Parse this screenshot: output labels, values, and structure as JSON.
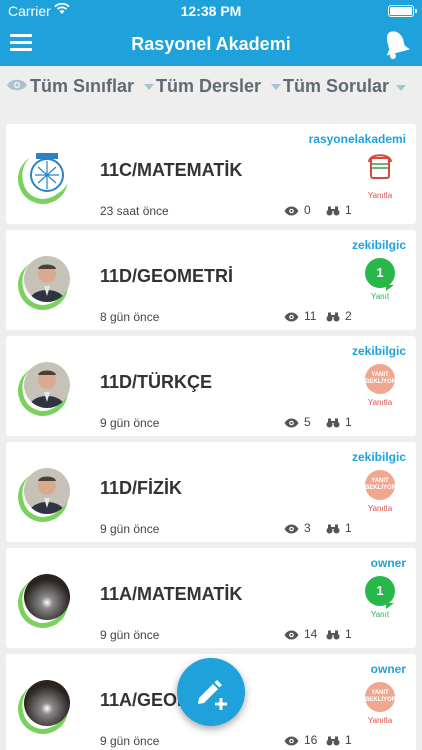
{
  "status_bar": {
    "carrier": "Carrier",
    "time": "12:38 PM"
  },
  "header": {
    "title": "Rasyonel Akademi"
  },
  "filters": {
    "classes": "Tüm Sınıflar",
    "subjects": "Tüm Dersler",
    "questions": "Tüm Sorular"
  },
  "questions": [
    {
      "user": "rasyonelakademi",
      "course": "11C/MATEMATİK",
      "time": "23 saat önce",
      "views": "0",
      "answers": "1",
      "status_label": "Yanıtla",
      "status_type": "waiting"
    },
    {
      "user": "zekibilgic",
      "course": "11D/GEOMETRİ",
      "time": "8 gün önce",
      "views": "11",
      "answers": "2",
      "status_label": "Yanıt",
      "status_count": "1",
      "status_type": "answered"
    },
    {
      "user": "zekibilgic",
      "course": "11D/TÜRKÇE",
      "time": "9 gün önce",
      "views": "5",
      "answers": "1",
      "status_label": "Yanıtla",
      "status_badge": "YANIT BEKLİYOR",
      "status_type": "pending"
    },
    {
      "user": "zekibilgic",
      "course": "11D/FİZİK",
      "time": "9 gün önce",
      "views": "3",
      "answers": "1",
      "status_label": "Yanıtla",
      "status_badge": "YANIT BEKLİYOR",
      "status_type": "pending"
    },
    {
      "user": "owner",
      "course": "11A/MATEMATİK",
      "time": "9 gün önce",
      "views": "14",
      "answers": "1",
      "status_label": "Yanıt",
      "status_count": "1",
      "status_type": "answered"
    },
    {
      "user": "owner",
      "course": "11A/GEOM",
      "time": "9 gün önce",
      "views": "16",
      "answers": "1",
      "status_label": "Yanıtla",
      "status_badge": "YANIT BEKLİYOR",
      "status_type": "pending"
    }
  ],
  "colors": {
    "primary": "#1fa2db",
    "answered": "#28b84a",
    "pending": "#f1a690",
    "pending_text": "#e0504a"
  },
  "icons": {
    "menu": "hamburger-icon",
    "notifications": "bell-icon",
    "views": "eye-icon",
    "answers": "binoculars-icon",
    "fab": "pencil-plus-icon"
  }
}
